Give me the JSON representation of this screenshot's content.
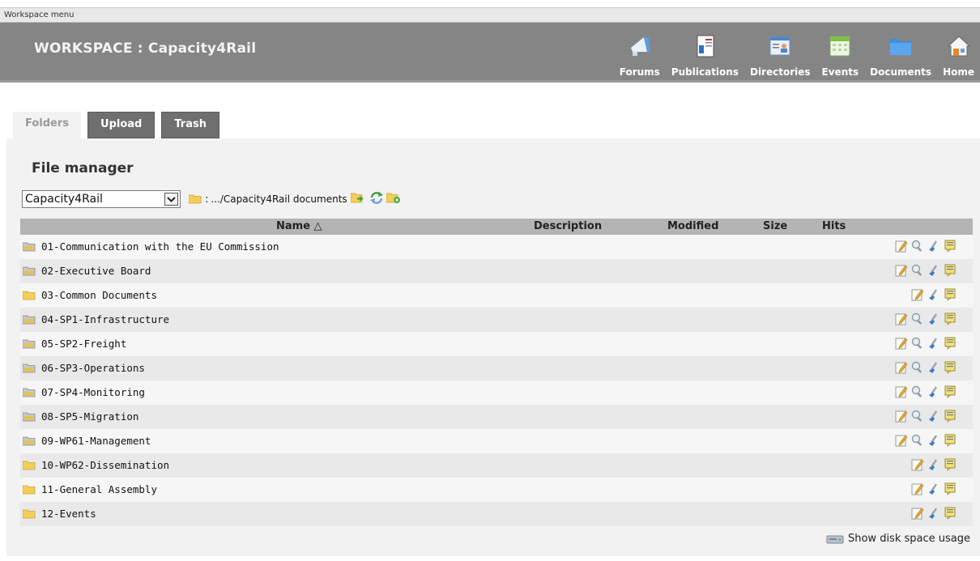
{
  "menu_bar": {
    "label": "Workspace menu"
  },
  "header": {
    "title": "WORKSPACE : Capacity4Rail"
  },
  "nav": [
    {
      "label": "Forums",
      "icon": "megaphone-icon"
    },
    {
      "label": "Publications",
      "icon": "publication-icon"
    },
    {
      "label": "Directories",
      "icon": "directory-card-icon"
    },
    {
      "label": "Events",
      "icon": "calendar-icon"
    },
    {
      "label": "Documents",
      "icon": "folder-icon"
    },
    {
      "label": "Home",
      "icon": "home-icon"
    }
  ],
  "tabs": [
    {
      "label": "Folders",
      "active": true
    },
    {
      "label": "Upload",
      "active": false
    },
    {
      "label": "Trash",
      "active": false
    }
  ],
  "file_manager": {
    "title": "File manager",
    "selected_folder": "Capacity4Rail",
    "path_separator": ":",
    "path": ".../Capacity4Rail documents",
    "columns": {
      "name": "Name △",
      "description": "Description",
      "modified": "Modified",
      "size": "Size",
      "hits": "Hits"
    },
    "rows": [
      {
        "name": "01-Communication with the EU Commission",
        "type": "restricted-folder",
        "actions": [
          "edit",
          "permissions",
          "tools",
          "comment"
        ]
      },
      {
        "name": "02-Executive Board",
        "type": "restricted-folder",
        "actions": [
          "edit",
          "permissions",
          "tools",
          "comment"
        ]
      },
      {
        "name": "03-Common Documents",
        "type": "folder",
        "actions": [
          "edit",
          "tools",
          "comment"
        ]
      },
      {
        "name": "04-SP1-Infrastructure",
        "type": "restricted-folder",
        "actions": [
          "edit",
          "permissions",
          "tools",
          "comment"
        ]
      },
      {
        "name": "05-SP2-Freight",
        "type": "restricted-folder",
        "actions": [
          "edit",
          "permissions",
          "tools",
          "comment"
        ]
      },
      {
        "name": "06-SP3-Operations",
        "type": "restricted-folder",
        "actions": [
          "edit",
          "permissions",
          "tools",
          "comment"
        ]
      },
      {
        "name": "07-SP4-Monitoring",
        "type": "restricted-folder",
        "actions": [
          "edit",
          "permissions",
          "tools",
          "comment"
        ]
      },
      {
        "name": "08-SP5-Migration",
        "type": "restricted-folder",
        "actions": [
          "edit",
          "permissions",
          "tools",
          "comment"
        ]
      },
      {
        "name": "09-WP61-Management",
        "type": "restricted-folder",
        "actions": [
          "edit",
          "permissions",
          "tools",
          "comment"
        ]
      },
      {
        "name": "10-WP62-Dissemination",
        "type": "folder",
        "actions": [
          "edit",
          "tools",
          "comment"
        ]
      },
      {
        "name": "11-General Assembly",
        "type": "folder",
        "actions": [
          "edit",
          "tools",
          "comment"
        ]
      },
      {
        "name": "12-Events",
        "type": "folder",
        "actions": [
          "edit",
          "tools",
          "comment"
        ]
      }
    ],
    "disk_usage_label": "Show disk space usage"
  },
  "colors": {
    "header_bg": "#888888",
    "tab_inactive": "#6f6f6f",
    "panel_bg": "#f2f2f2",
    "folder_yellow": "#f3cf5a"
  }
}
